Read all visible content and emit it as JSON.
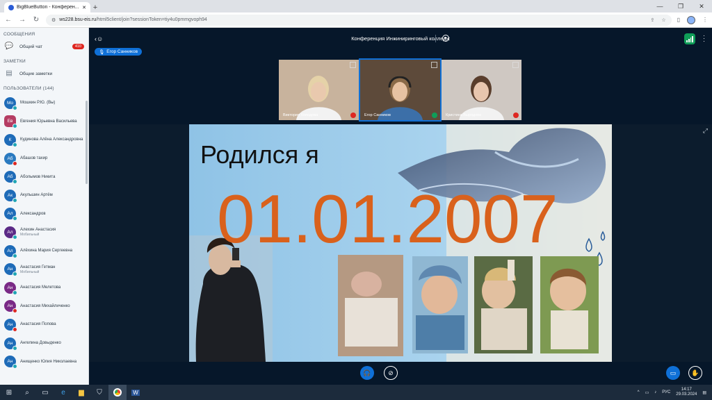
{
  "browser": {
    "tab_title": "BigBlueButton - Конферен...",
    "url_host": "ws228.bsu-eis.ru",
    "url_path": "/html5client/join?sessionToken=tiy4u0pmmgvoph94"
  },
  "sidebar": {
    "messages_title": "СООБЩЕНИЯ",
    "public_chat": "Общий чат",
    "chat_badge": "410",
    "notes_title": "ЗАМЕТКИ",
    "shared_notes": "Общие заметки",
    "users_title": "ПОЛЬЗОВАТЕЛИ (144)",
    "users": [
      {
        "initials": "Мо",
        "name": "Мошкин Р.Ю. (Вы)",
        "sub": "",
        "color": "#1e6bb8",
        "dot": "#1ea5b4"
      },
      {
        "initials": "Ев",
        "name": "Евгения Юрьевна Васильева",
        "sub": "",
        "color": "#b53d63",
        "dot": "#1ea5b4"
      },
      {
        "initials": "К",
        "name": "Кудинова Алёна Александровна",
        "sub": "",
        "color": "#1e6bb8",
        "dot": "#1ea5b4"
      },
      {
        "initials": "Аб",
        "name": "Абашов тахир",
        "sub": "",
        "color": "#2a7ac0",
        "dot": "#de2721"
      },
      {
        "initials": "Аб",
        "name": "Аболымов Никита",
        "sub": "",
        "color": "#1e6bb8",
        "dot": "#1ea5b4"
      },
      {
        "initials": "Ак",
        "name": "Акульшин Артём",
        "sub": "",
        "color": "#1e6bb8",
        "dot": "#1ea5b4"
      },
      {
        "initials": "Ал",
        "name": "Александров",
        "sub": "",
        "color": "#1e6bb8",
        "dot": "#1ea5b4"
      },
      {
        "initials": "Ал",
        "name": "Алехин Анастасия",
        "sub": "Мобильный",
        "color": "#5b2a86",
        "dot": "#1ea5b4"
      },
      {
        "initials": "Ал",
        "name": "Алёхина Мария Сергеевна",
        "sub": "",
        "color": "#1e6bb8",
        "dot": "#1ea5b4"
      },
      {
        "initials": "Ан",
        "name": "Анастасия Гетман",
        "sub": "Мобильный",
        "color": "#1e6bb8",
        "dot": "#1ea5b4"
      },
      {
        "initials": "Ан",
        "name": "Анастасия Мелетова",
        "sub": "",
        "color": "#7a2a86",
        "dot": "#1ea5b4"
      },
      {
        "initials": "Ан",
        "name": "Анастасия Михайличенко",
        "sub": "",
        "color": "#7a2a86",
        "dot": "#de2721"
      },
      {
        "initials": "Ан",
        "name": "Анастасия Попова",
        "sub": "",
        "color": "#1e6bb8",
        "dot": "#de2721"
      },
      {
        "initials": "Ан",
        "name": "Ангелина Довыденко",
        "sub": "",
        "color": "#1e6bb8",
        "dot": "#1ea5b4"
      },
      {
        "initials": "Ан",
        "name": "Анищенко Юлия Николаевна",
        "sub": "",
        "color": "#1e6bb8",
        "dot": "#1ea5b4"
      }
    ]
  },
  "meeting": {
    "title": "Конференция Инжиниринговый колледж",
    "talking": "Егор Санников"
  },
  "videos": [
    {
      "name": "Виктория Холодова",
      "bg": "#c8b39d",
      "face": "#e9c9ae",
      "hair": "#e5d2a8",
      "muted": true
    },
    {
      "name": "Егор Санников",
      "bg": "#5d4a3a",
      "face": "#e7c2a2",
      "hair": "#8a6a48",
      "muted": false
    },
    {
      "name": "Кристина Выродова",
      "bg": "#cfc8c2",
      "face": "#e8c6ae",
      "hair": "#5a3e2c",
      "muted": true
    }
  ],
  "slide": {
    "heading": "Родился я",
    "date": "01.01.2007"
  },
  "taskbar": {
    "lang": "РУС",
    "time": "14:17",
    "date": "29.03.2024"
  }
}
